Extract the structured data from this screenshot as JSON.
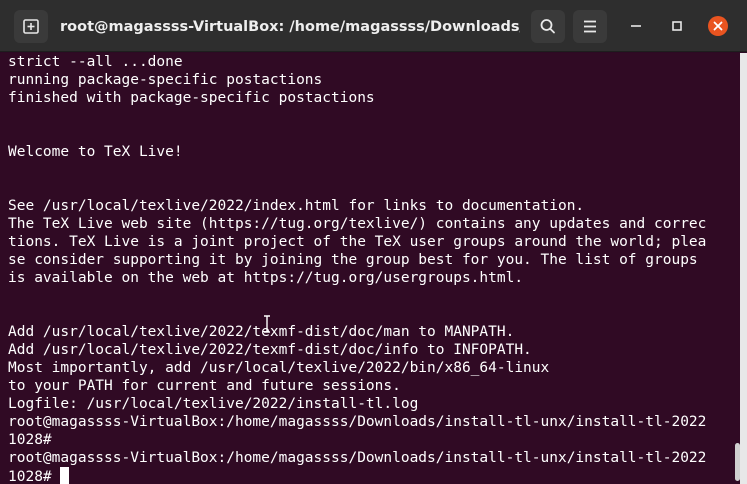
{
  "window": {
    "title": "root@magassss-VirtualBox: /home/magassss/Downloads/in..."
  },
  "icons": {
    "new_tab": "new-tab-icon",
    "search": "search-icon",
    "menu": "hamburger-menu-icon",
    "minimize": "minimize-icon",
    "maximize": "maximize-icon",
    "close": "close-icon"
  },
  "colors": {
    "terminal_bg": "#300a24",
    "titlebar_bg": "#2e2e2e",
    "close_button": "#e95420"
  },
  "terminal": {
    "lines": [
      "strict --all ...done",
      "running package-specific postactions",
      "finished with package-specific postactions",
      "",
      "",
      "Welcome to TeX Live!",
      "",
      "",
      "See /usr/local/texlive/2022/index.html for links to documentation.",
      "The TeX Live web site (https://tug.org/texlive/) contains any updates and correc",
      "tions. TeX Live is a joint project of the TeX user groups around the world; plea",
      "se consider supporting it by joining the group best for you. The list of groups",
      "is available on the web at https://tug.org/usergroups.html.",
      "",
      "",
      "Add /usr/local/texlive/2022/texmf-dist/doc/man to MANPATH.",
      "Add /usr/local/texlive/2022/texmf-dist/doc/info to INFOPATH.",
      "Most importantly, add /usr/local/texlive/2022/bin/x86_64-linux",
      "to your PATH for current and future sessions.",
      "Logfile: /usr/local/texlive/2022/install-tl.log",
      "root@magassss-VirtualBox:/home/magassss/Downloads/install-tl-unx/install-tl-2022",
      "1028# ",
      "root@magassss-VirtualBox:/home/magassss/Downloads/install-tl-unx/install-tl-2022",
      "1028# "
    ]
  }
}
